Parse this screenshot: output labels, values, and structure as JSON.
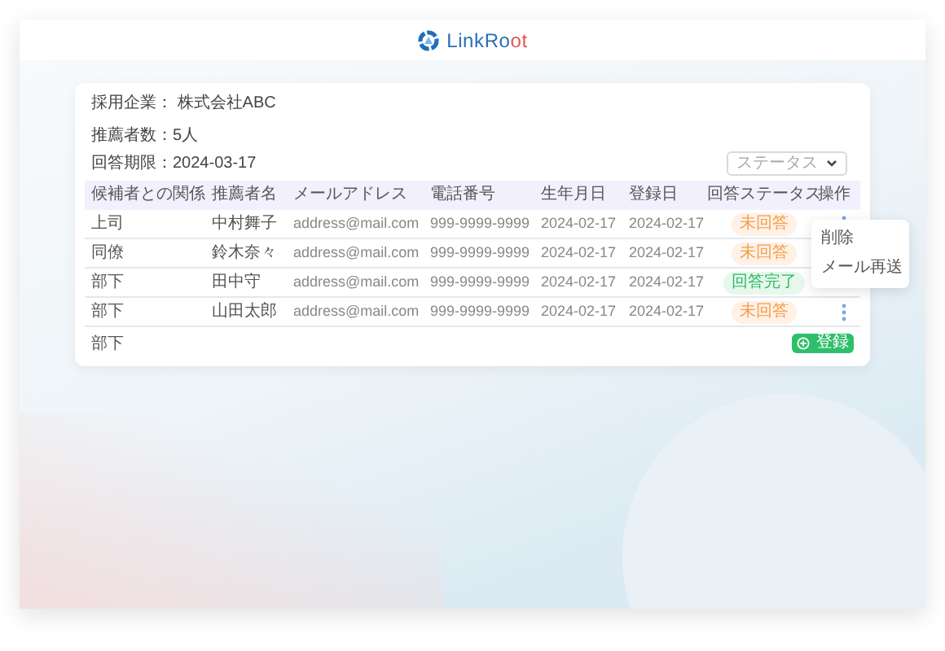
{
  "logo": [
    {
      "text": "LinkRo",
      "accent": false
    },
    {
      "text": "ot",
      "accent": true
    }
  ],
  "company": "採用企業： 株式会社ABC",
  "count": "推薦者数：5人",
  "deadline": "回答期限：2024-03-17",
  "status_filter": {
    "placeholder": "ステータス"
  },
  "table": {
    "columns": [
      "候補者との関係",
      "推薦者名",
      "メールアドレス",
      "電話番号",
      "生年月日",
      "登録日",
      "回答ステータス",
      "操作"
    ],
    "rows": [
      {
        "cells": [
          "上司",
          "中村舞子",
          "address@mail.com",
          "999-9999-9999",
          "2024-02-17",
          "2024-02-17"
        ],
        "status": {
          "text": "未回答",
          "kind": "pending"
        },
        "menu_button": true
      },
      {
        "cells": [
          "同僚",
          "鈴木奈々",
          "address@mail.com",
          "999-9999-9999",
          "2024-02-17",
          "2024-02-17"
        ],
        "status": {
          "text": "未回答",
          "kind": "pending"
        },
        "menu_button": false
      },
      {
        "cells": [
          "部下",
          "田中守",
          "address@mail.com",
          "999-9999-9999",
          "2024-02-17",
          "2024-02-17"
        ],
        "status": {
          "text": "回答完了",
          "kind": "done"
        },
        "menu_button": false
      },
      {
        "cells": [
          "部下",
          "山田太郎",
          "address@mail.com",
          "999-9999-9999",
          "2024-02-17",
          "2024-02-17"
        ],
        "status": {
          "text": "未回答",
          "kind": "pending"
        },
        "menu_button": true
      }
    ],
    "new_row": {
      "relation": "部下",
      "button": "登録"
    }
  },
  "row_menu": [
    "削除",
    "メール再送"
  ]
}
